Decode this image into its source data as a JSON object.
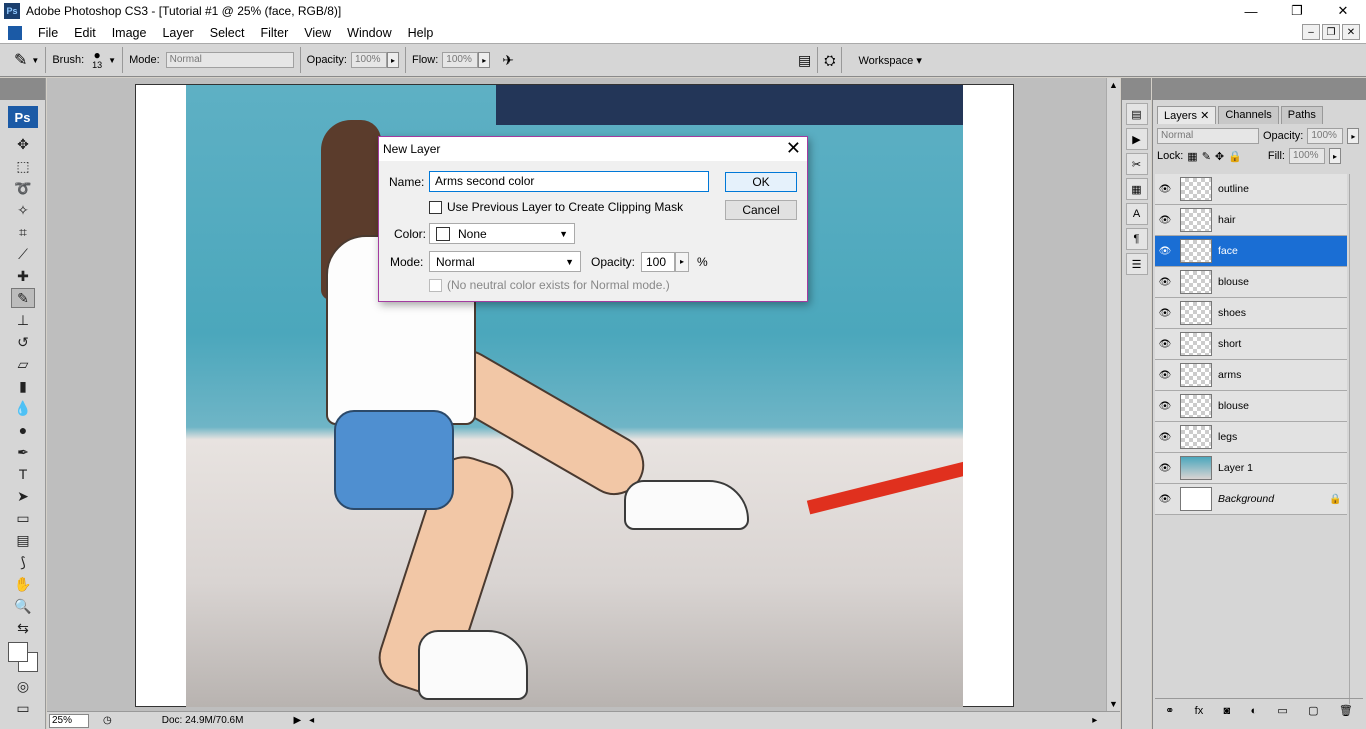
{
  "window": {
    "title": "Adobe Photoshop CS3 - [Tutorial #1 @ 25% (face, RGB/8)]",
    "app_badge": "Ps",
    "controls": {
      "minimize": "—",
      "restore": "❐",
      "close": "✕"
    }
  },
  "menu": [
    "File",
    "Edit",
    "Image",
    "Layer",
    "Select",
    "Filter",
    "View",
    "Window",
    "Help"
  ],
  "doc_controls": {
    "minimize": "–",
    "restore": "❐",
    "close": "✕"
  },
  "options": {
    "brush_label": "Brush:",
    "brush_size": "13",
    "mode_label": "Mode:",
    "mode_value": "Normal",
    "opacity_label": "Opacity:",
    "opacity_value": "100%",
    "flow_label": "Flow:",
    "flow_value": "100%",
    "workspace_label": "Workspace ▾"
  },
  "toolbox": {
    "logo": "Ps"
  },
  "status": {
    "zoom": "25%",
    "doc": "Doc: 24.9M/70.6M"
  },
  "layers_panel": {
    "tabs": [
      "Layers",
      "Channels",
      "Paths"
    ],
    "blend_mode": "Normal",
    "opacity_label": "Opacity:",
    "opacity_value": "100%",
    "lock_label": "Lock:",
    "fill_label": "Fill:",
    "fill_value": "100%",
    "layers": [
      {
        "name": "outline"
      },
      {
        "name": "hair"
      },
      {
        "name": "face"
      },
      {
        "name": "blouse"
      },
      {
        "name": "shoes"
      },
      {
        "name": "short"
      },
      {
        "name": "arms"
      },
      {
        "name": "blouse"
      },
      {
        "name": "legs"
      },
      {
        "name": "Layer 1"
      },
      {
        "name": "Background"
      }
    ]
  },
  "dialog": {
    "title": "New Layer",
    "name_label": "Name:",
    "name_value": "Arms second color",
    "clip_label": "Use Previous Layer to Create Clipping Mask",
    "color_label": "Color:",
    "color_value": "None",
    "mode_label": "Mode:",
    "mode_value": "Normal",
    "opacity_label": "Opacity:",
    "opacity_value": "100",
    "percent": "%",
    "neutral_label": "(No neutral color exists for Normal mode.)",
    "ok": "OK",
    "cancel": "Cancel"
  },
  "colors": {
    "selection": "#1a6ed4",
    "dialog_border": "#a33ba0",
    "accent": "#0078d7"
  }
}
